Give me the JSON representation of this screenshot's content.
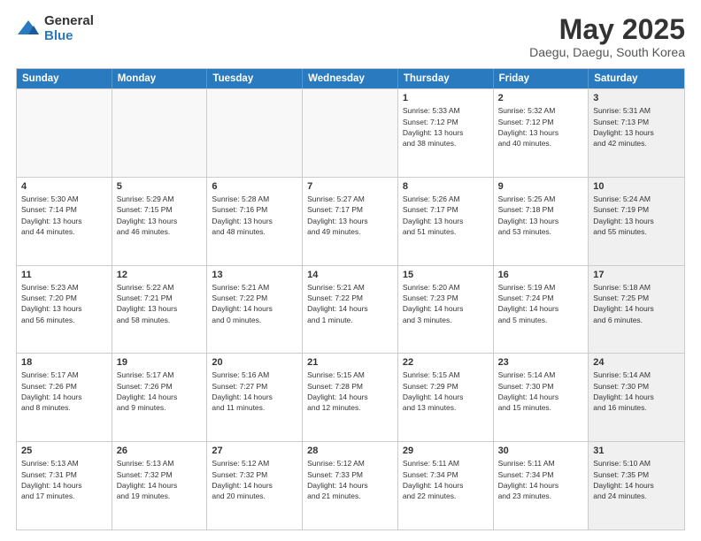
{
  "logo": {
    "general": "General",
    "blue": "Blue"
  },
  "title": {
    "month": "May 2025",
    "location": "Daegu, Daegu, South Korea"
  },
  "weekdays": [
    "Sunday",
    "Monday",
    "Tuesday",
    "Wednesday",
    "Thursday",
    "Friday",
    "Saturday"
  ],
  "rows": [
    [
      {
        "day": "",
        "detail": "",
        "empty": true
      },
      {
        "day": "",
        "detail": "",
        "empty": true
      },
      {
        "day": "",
        "detail": "",
        "empty": true
      },
      {
        "day": "",
        "detail": "",
        "empty": true
      },
      {
        "day": "1",
        "detail": "Sunrise: 5:33 AM\nSunset: 7:12 PM\nDaylight: 13 hours\nand 38 minutes."
      },
      {
        "day": "2",
        "detail": "Sunrise: 5:32 AM\nSunset: 7:12 PM\nDaylight: 13 hours\nand 40 minutes."
      },
      {
        "day": "3",
        "detail": "Sunrise: 5:31 AM\nSunset: 7:13 PM\nDaylight: 13 hours\nand 42 minutes.",
        "shaded": true
      }
    ],
    [
      {
        "day": "4",
        "detail": "Sunrise: 5:30 AM\nSunset: 7:14 PM\nDaylight: 13 hours\nand 44 minutes."
      },
      {
        "day": "5",
        "detail": "Sunrise: 5:29 AM\nSunset: 7:15 PM\nDaylight: 13 hours\nand 46 minutes."
      },
      {
        "day": "6",
        "detail": "Sunrise: 5:28 AM\nSunset: 7:16 PM\nDaylight: 13 hours\nand 48 minutes."
      },
      {
        "day": "7",
        "detail": "Sunrise: 5:27 AM\nSunset: 7:17 PM\nDaylight: 13 hours\nand 49 minutes."
      },
      {
        "day": "8",
        "detail": "Sunrise: 5:26 AM\nSunset: 7:17 PM\nDaylight: 13 hours\nand 51 minutes."
      },
      {
        "day": "9",
        "detail": "Sunrise: 5:25 AM\nSunset: 7:18 PM\nDaylight: 13 hours\nand 53 minutes."
      },
      {
        "day": "10",
        "detail": "Sunrise: 5:24 AM\nSunset: 7:19 PM\nDaylight: 13 hours\nand 55 minutes.",
        "shaded": true
      }
    ],
    [
      {
        "day": "11",
        "detail": "Sunrise: 5:23 AM\nSunset: 7:20 PM\nDaylight: 13 hours\nand 56 minutes."
      },
      {
        "day": "12",
        "detail": "Sunrise: 5:22 AM\nSunset: 7:21 PM\nDaylight: 13 hours\nand 58 minutes."
      },
      {
        "day": "13",
        "detail": "Sunrise: 5:21 AM\nSunset: 7:22 PM\nDaylight: 14 hours\nand 0 minutes."
      },
      {
        "day": "14",
        "detail": "Sunrise: 5:21 AM\nSunset: 7:22 PM\nDaylight: 14 hours\nand 1 minute."
      },
      {
        "day": "15",
        "detail": "Sunrise: 5:20 AM\nSunset: 7:23 PM\nDaylight: 14 hours\nand 3 minutes."
      },
      {
        "day": "16",
        "detail": "Sunrise: 5:19 AM\nSunset: 7:24 PM\nDaylight: 14 hours\nand 5 minutes."
      },
      {
        "day": "17",
        "detail": "Sunrise: 5:18 AM\nSunset: 7:25 PM\nDaylight: 14 hours\nand 6 minutes.",
        "shaded": true
      }
    ],
    [
      {
        "day": "18",
        "detail": "Sunrise: 5:17 AM\nSunset: 7:26 PM\nDaylight: 14 hours\nand 8 minutes."
      },
      {
        "day": "19",
        "detail": "Sunrise: 5:17 AM\nSunset: 7:26 PM\nDaylight: 14 hours\nand 9 minutes."
      },
      {
        "day": "20",
        "detail": "Sunrise: 5:16 AM\nSunset: 7:27 PM\nDaylight: 14 hours\nand 11 minutes."
      },
      {
        "day": "21",
        "detail": "Sunrise: 5:15 AM\nSunset: 7:28 PM\nDaylight: 14 hours\nand 12 minutes."
      },
      {
        "day": "22",
        "detail": "Sunrise: 5:15 AM\nSunset: 7:29 PM\nDaylight: 14 hours\nand 13 minutes."
      },
      {
        "day": "23",
        "detail": "Sunrise: 5:14 AM\nSunset: 7:30 PM\nDaylight: 14 hours\nand 15 minutes."
      },
      {
        "day": "24",
        "detail": "Sunrise: 5:14 AM\nSunset: 7:30 PM\nDaylight: 14 hours\nand 16 minutes.",
        "shaded": true
      }
    ],
    [
      {
        "day": "25",
        "detail": "Sunrise: 5:13 AM\nSunset: 7:31 PM\nDaylight: 14 hours\nand 17 minutes."
      },
      {
        "day": "26",
        "detail": "Sunrise: 5:13 AM\nSunset: 7:32 PM\nDaylight: 14 hours\nand 19 minutes."
      },
      {
        "day": "27",
        "detail": "Sunrise: 5:12 AM\nSunset: 7:32 PM\nDaylight: 14 hours\nand 20 minutes."
      },
      {
        "day": "28",
        "detail": "Sunrise: 5:12 AM\nSunset: 7:33 PM\nDaylight: 14 hours\nand 21 minutes."
      },
      {
        "day": "29",
        "detail": "Sunrise: 5:11 AM\nSunset: 7:34 PM\nDaylight: 14 hours\nand 22 minutes."
      },
      {
        "day": "30",
        "detail": "Sunrise: 5:11 AM\nSunset: 7:34 PM\nDaylight: 14 hours\nand 23 minutes."
      },
      {
        "day": "31",
        "detail": "Sunrise: 5:10 AM\nSunset: 7:35 PM\nDaylight: 14 hours\nand 24 minutes.",
        "shaded": true
      }
    ]
  ]
}
